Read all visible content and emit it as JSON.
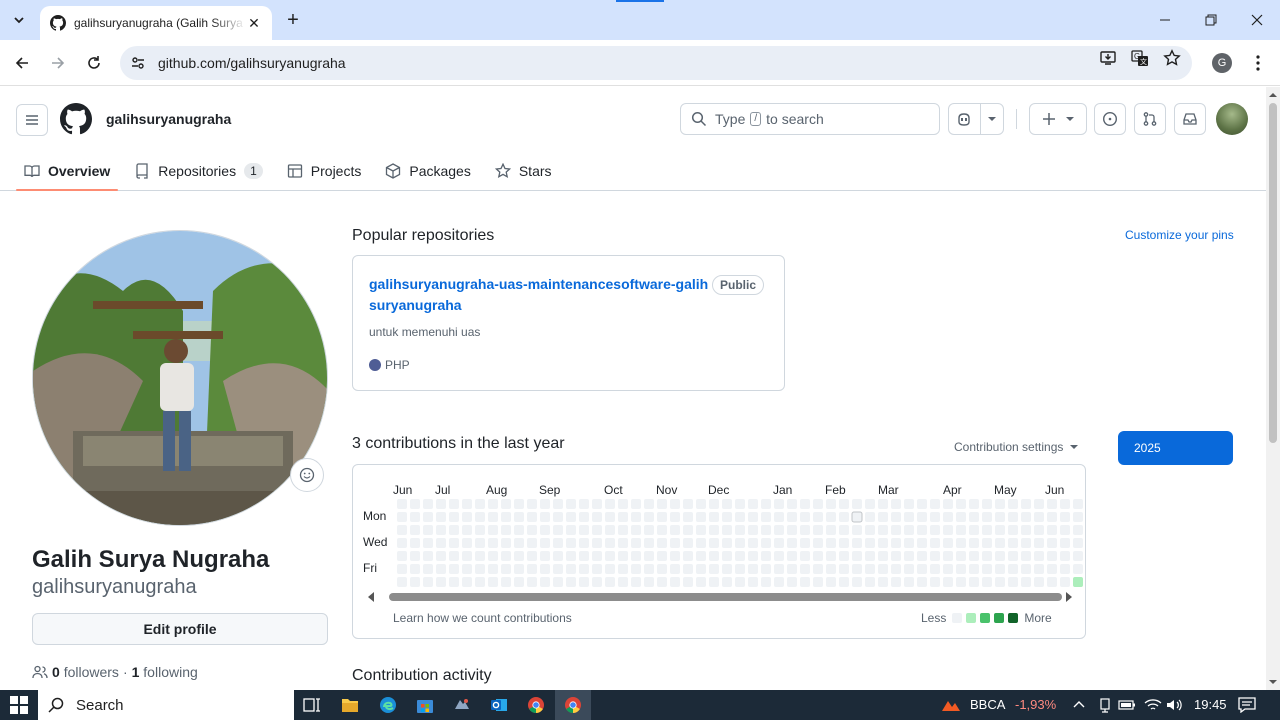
{
  "browser": {
    "tab_title": "galihsuryanugraha (Galih Surya Nugraha)",
    "url": "github.com/galihsuryanugraha",
    "profile_initial": "G"
  },
  "header": {
    "username": "galihsuryanugraha",
    "search_prefix": "Type",
    "search_key": "/",
    "search_suffix": "to search"
  },
  "nav_tabs": [
    {
      "label": "Overview"
    },
    {
      "label": "Repositories",
      "count": "1"
    },
    {
      "label": "Projects"
    },
    {
      "label": "Packages"
    },
    {
      "label": "Stars"
    }
  ],
  "profile": {
    "full_name": "Galih Surya Nugraha",
    "login": "galihsuryanugraha",
    "edit_label": "Edit profile",
    "followers_count": "0",
    "followers_label": "followers",
    "separator": "·",
    "following_count": "1",
    "following_label": "following"
  },
  "popular": {
    "title": "Popular repositories",
    "customize_label": "Customize your pins",
    "repo": {
      "name": "galihsuryanugraha-uas-maintenancesoftware-galihsuryanugraha",
      "visibility": "Public",
      "description": "untuk memenuhi uas",
      "language": "PHP",
      "language_color": "#4F5D95"
    }
  },
  "contributions": {
    "title": "3 contributions in the last year",
    "settings_label": "Contribution settings",
    "year": "2025",
    "months": [
      "Jun",
      "Jul",
      "Aug",
      "Sep",
      "Oct",
      "Nov",
      "Dec",
      "Jan",
      "Feb",
      "Mar",
      "Apr",
      "May",
      "Jun"
    ],
    "days": [
      "Mon",
      "Wed",
      "Fri"
    ],
    "learn_label": "Learn how we count contributions",
    "less_label": "Less",
    "more_label": "More",
    "legend_colors": [
      "#eff2f5",
      "#aceebb",
      "#4ac26b",
      "#2da44e",
      "#116329"
    ]
  },
  "activity": {
    "title": "Contribution activity"
  },
  "taskbar": {
    "search_label": "Search",
    "stock_name": "BBCA",
    "stock_change": "-1,93%",
    "time": "19:45"
  }
}
